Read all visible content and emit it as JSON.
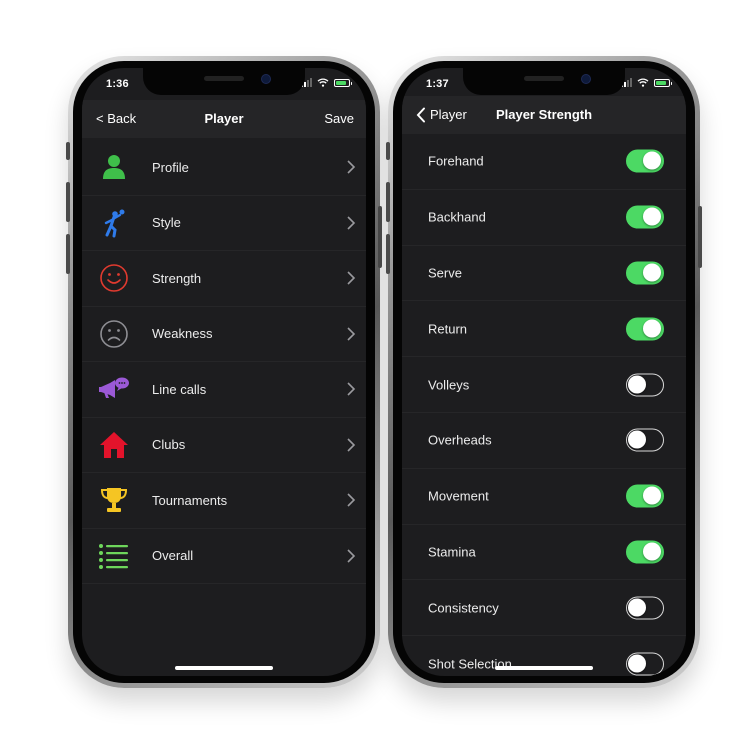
{
  "left_screen": {
    "status": {
      "time": "1:36"
    },
    "nav": {
      "back": "< Back",
      "title": "Player",
      "save": "Save"
    },
    "items": [
      {
        "label": "Profile",
        "icon": "profile-icon",
        "color": "#3fbf4a"
      },
      {
        "label": "Style",
        "icon": "tennis-player-icon",
        "color": "#2f7bea"
      },
      {
        "label": "Strength",
        "icon": "smiley-face-icon",
        "color": "#e03a2f"
      },
      {
        "label": "Weakness",
        "icon": "sad-face-icon",
        "color": "#8e8e93"
      },
      {
        "label": "Line calls",
        "icon": "megaphone-icon",
        "color": "#9b59d6"
      },
      {
        "label": "Clubs",
        "icon": "house-icon",
        "color": "#e3132b"
      },
      {
        "label": "Tournaments",
        "icon": "trophy-icon",
        "color": "#f5c523"
      },
      {
        "label": "Overall",
        "icon": "list-icon",
        "color": "#6ed65b"
      }
    ]
  },
  "right_screen": {
    "status": {
      "time": "1:37"
    },
    "nav": {
      "back": "Player",
      "title": "Player Strength"
    },
    "toggles": [
      {
        "label": "Forehand",
        "on": true
      },
      {
        "label": "Backhand",
        "on": true
      },
      {
        "label": "Serve",
        "on": true
      },
      {
        "label": "Return",
        "on": true
      },
      {
        "label": "Volleys",
        "on": false
      },
      {
        "label": "Overheads",
        "on": false
      },
      {
        "label": "Movement",
        "on": true
      },
      {
        "label": "Stamina",
        "on": true
      },
      {
        "label": "Consistency",
        "on": false
      },
      {
        "label": "Shot Selection",
        "on": false
      }
    ]
  },
  "colors": {
    "toggle_on": "#4cd964",
    "background": "#1d1d1f",
    "navbar": "#252527"
  }
}
